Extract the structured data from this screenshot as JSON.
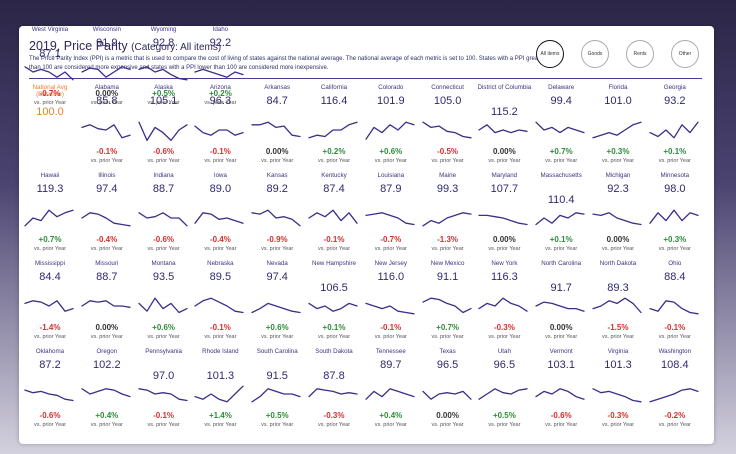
{
  "header": {
    "title": "2019, Price Parity",
    "category": "(Category: All items)",
    "description": "The Price Parity Index (PPI) is a metric that is used to compare the cost of living of states against the national average. The national average of each metric is set to 100. States with a PPI greater than 100 are considered more expensive and states with a PPI lower than 100 are considered more inexpensive."
  },
  "filters": [
    {
      "label": "All items",
      "active": true
    },
    {
      "label": "Goods",
      "active": false
    },
    {
      "label": "Rents",
      "active": false
    },
    {
      "label": "Other",
      "active": false
    }
  ],
  "colors": {
    "accent": "#3d2d8a",
    "national": "#e8822a",
    "negative": "#d32f2f",
    "positive": "#2e8b3a"
  },
  "national": {
    "name": "National Avg (Baseline)",
    "value": "100.0"
  },
  "states": [
    {
      "name": "Alabama",
      "value": "85.8",
      "change": "-0.1%",
      "sub": "vs. prior Year",
      "trend": [
        0.4,
        0.3,
        0.45,
        0.5,
        0.3,
        0.8,
        0.7
      ]
    },
    {
      "name": "Alaska",
      "value": "105.1",
      "change": "-0.6%",
      "sub": "vs. prior Year",
      "trend": [
        0.2,
        0.9,
        0.4,
        0.6,
        0.9,
        0.5,
        0.3
      ]
    },
    {
      "name": "Arizona",
      "value": "96.3",
      "change": "-0.1%",
      "sub": "vs. prior Year",
      "trend": [
        0.35,
        0.6,
        0.7,
        0.5,
        0.5,
        0.7,
        0.6
      ]
    },
    {
      "name": "Arkansas",
      "value": "84.7",
      "change": "0.00%",
      "sub": "vs. prior Year",
      "trend": [
        0.3,
        0.3,
        0.2,
        0.4,
        0.35,
        0.7,
        0.75
      ]
    },
    {
      "name": "California",
      "value": "116.4",
      "change": "+0.2%",
      "sub": "vs. prior Year",
      "trend": [
        0.8,
        0.7,
        0.75,
        0.5,
        0.5,
        0.3,
        0.2
      ]
    },
    {
      "name": "Colorado",
      "value": "101.9",
      "change": "+0.6%",
      "sub": "vs. prior Year",
      "trend": [
        0.85,
        0.4,
        0.6,
        0.3,
        0.5,
        0.2,
        0.3
      ]
    },
    {
      "name": "Connecticut",
      "value": "105.0",
      "change": "-0.5%",
      "sub": "vs. prior Year",
      "trend": [
        0.2,
        0.4,
        0.35,
        0.55,
        0.6,
        0.75,
        0.8
      ]
    },
    {
      "name": "District of Columbia",
      "value": "115.2",
      "change": "0.00%",
      "sub": "vs. prior Year",
      "trend": [
        0.5,
        0.3,
        0.6,
        0.5,
        0.6,
        0.5,
        0.55
      ]
    },
    {
      "name": "Delaware",
      "value": "99.4",
      "change": "+0.7%",
      "sub": "vs. prior Year",
      "trend": [
        0.2,
        0.5,
        0.4,
        0.6,
        0.4,
        0.5,
        0.6
      ]
    },
    {
      "name": "Florida",
      "value": "101.0",
      "change": "+0.3%",
      "sub": "vs. prior Year",
      "trend": [
        0.8,
        0.7,
        0.6,
        0.7,
        0.5,
        0.3,
        0.2
      ]
    },
    {
      "name": "Georgia",
      "value": "93.2",
      "change": "+0.1%",
      "sub": "vs. prior Year",
      "trend": [
        0.6,
        0.75,
        0.5,
        0.8,
        0.3,
        0.6,
        0.2
      ]
    },
    {
      "name": "Hawaii",
      "value": "119.3",
      "change": "+0.7%",
      "sub": "vs. prior Year",
      "trend": [
        0.8,
        0.5,
        0.6,
        0.2,
        0.45,
        0.3,
        0.2
      ]
    },
    {
      "name": "Illinois",
      "value": "97.4",
      "change": "-0.4%",
      "sub": "vs. prior Year",
      "trend": [
        0.5,
        0.3,
        0.35,
        0.5,
        0.7,
        0.75,
        0.8
      ]
    },
    {
      "name": "Indiana",
      "value": "88.7",
      "change": "-0.6%",
      "sub": "vs. prior Year",
      "trend": [
        0.3,
        0.5,
        0.45,
        0.3,
        0.5,
        0.5,
        0.8
      ]
    },
    {
      "name": "Iowa",
      "value": "89.0",
      "change": "-0.4%",
      "sub": "vs. prior Year",
      "trend": [
        0.7,
        0.3,
        0.35,
        0.55,
        0.5,
        0.6,
        0.7
      ]
    },
    {
      "name": "Kansas",
      "value": "89.2",
      "change": "-0.9%",
      "sub": "vs. prior Year",
      "trend": [
        0.3,
        0.35,
        0.2,
        0.5,
        0.45,
        0.55,
        0.8
      ]
    },
    {
      "name": "Kentucky",
      "value": "87.4",
      "change": "-0.1%",
      "sub": "vs. prior Year",
      "trend": [
        0.5,
        0.3,
        0.45,
        0.2,
        0.6,
        0.3,
        0.7
      ]
    },
    {
      "name": "Louisiana",
      "value": "87.9",
      "change": "-0.7%",
      "sub": "vs. prior Year",
      "trend": [
        0.4,
        0.35,
        0.3,
        0.4,
        0.5,
        0.7,
        0.75
      ]
    },
    {
      "name": "Maine",
      "value": "99.3",
      "change": "-1.3%",
      "sub": "vs. prior Year",
      "trend": [
        0.8,
        0.6,
        0.7,
        0.5,
        0.4,
        0.3,
        0.35
      ]
    },
    {
      "name": "Maryland",
      "value": "107.7",
      "change": "0.00%",
      "sub": "vs. prior Year",
      "trend": [
        0.4,
        0.4,
        0.45,
        0.5,
        0.6,
        0.7,
        0.75
      ]
    },
    {
      "name": "Massachusetts",
      "value": "110.4",
      "change": "+0.1%",
      "sub": "vs. prior Year",
      "trend": [
        0.75,
        0.5,
        0.7,
        0.4,
        0.5,
        0.3,
        0.35
      ]
    },
    {
      "name": "Michigan",
      "value": "92.3",
      "change": "0.00%",
      "sub": "vs. prior Year",
      "trend": [
        0.35,
        0.4,
        0.3,
        0.5,
        0.6,
        0.7,
        0.75
      ]
    },
    {
      "name": "Minnesota",
      "value": "98.0",
      "change": "+0.3%",
      "sub": "vs. prior Year",
      "trend": [
        0.7,
        0.3,
        0.6,
        0.2,
        0.6,
        0.3,
        0.4
      ]
    },
    {
      "name": "Mississippi",
      "value": "84.4",
      "change": "-1.4%",
      "sub": "vs. prior Year",
      "trend": [
        0.4,
        0.3,
        0.35,
        0.5,
        0.3,
        0.7,
        0.6
      ]
    },
    {
      "name": "Missouri",
      "value": "88.7",
      "change": "0.00%",
      "sub": "vs. prior Year",
      "trend": [
        0.5,
        0.3,
        0.35,
        0.3,
        0.5,
        0.5,
        0.55
      ]
    },
    {
      "name": "Montana",
      "value": "93.5",
      "change": "+0.6%",
      "sub": "vs. prior Year",
      "trend": [
        0.4,
        0.7,
        0.2,
        0.6,
        0.4,
        0.75,
        0.6
      ]
    },
    {
      "name": "Nebraska",
      "value": "89.5",
      "change": "-0.1%",
      "sub": "vs. prior Year",
      "trend": [
        0.5,
        0.3,
        0.2,
        0.35,
        0.5,
        0.7,
        0.75
      ]
    },
    {
      "name": "Nevada",
      "value": "97.4",
      "change": "+0.6%",
      "sub": "vs. prior Year",
      "trend": [
        0.75,
        0.6,
        0.4,
        0.5,
        0.6,
        0.7,
        0.75
      ]
    },
    {
      "name": "New Hampshire",
      "value": "106.5",
      "change": "+0.1%",
      "sub": "vs. prior Year",
      "trend": [
        0.4,
        0.6,
        0.5,
        0.7,
        0.6,
        0.4,
        0.5
      ]
    },
    {
      "name": "New Jersey",
      "value": "116.0",
      "change": "-0.1%",
      "sub": "vs. prior Year",
      "trend": [
        0.4,
        0.5,
        0.6,
        0.5,
        0.7,
        0.75,
        0.8
      ]
    },
    {
      "name": "New Mexico",
      "value": "91.1",
      "change": "+0.7%",
      "sub": "vs. prior Year",
      "trend": [
        0.35,
        0.2,
        0.25,
        0.4,
        0.5,
        0.75,
        0.6
      ]
    },
    {
      "name": "New York",
      "value": "116.3",
      "change": "-0.3%",
      "sub": "vs. prior Year",
      "trend": [
        0.6,
        0.4,
        0.5,
        0.2,
        0.4,
        0.5,
        0.7
      ]
    },
    {
      "name": "North Carolina",
      "value": "91.7",
      "change": "0.00%",
      "sub": "vs. prior Year",
      "trend": [
        0.5,
        0.35,
        0.4,
        0.5,
        0.6,
        0.6,
        0.7
      ]
    },
    {
      "name": "North Dakota",
      "value": "89.3",
      "change": "-1.5%",
      "sub": "vs. prior Year",
      "trend": [
        0.6,
        0.5,
        0.3,
        0.4,
        0.2,
        0.4,
        0.75
      ]
    },
    {
      "name": "Ohio",
      "value": "88.4",
      "change": "-0.1%",
      "sub": "vs. prior Year",
      "trend": [
        0.6,
        0.7,
        0.3,
        0.35,
        0.6,
        0.75,
        0.8
      ]
    },
    {
      "name": "Oklahoma",
      "value": "87.2",
      "change": "-0.6%",
      "sub": "vs. prior Year",
      "trend": [
        0.35,
        0.45,
        0.4,
        0.5,
        0.55,
        0.7,
        0.75
      ]
    },
    {
      "name": "Oregon",
      "value": "102.2",
      "change": "+0.4%",
      "sub": "vs. prior Year",
      "trend": [
        0.3,
        0.5,
        0.4,
        0.3,
        0.35,
        0.5,
        0.6
      ]
    },
    {
      "name": "Pennsylvania",
      "value": "97.0",
      "change": "-0.1%",
      "sub": "vs. prior Year",
      "trend": [
        0.3,
        0.35,
        0.5,
        0.45,
        0.5,
        0.7,
        0.75
      ]
    },
    {
      "name": "Rhode Island",
      "value": "101.3",
      "change": "+1.4%",
      "sub": "vs. prior Year",
      "trend": [
        0.6,
        0.7,
        0.5,
        0.7,
        0.8,
        0.5,
        0.2
      ]
    },
    {
      "name": "South Carolina",
      "value": "91.5",
      "change": "+0.5%",
      "sub": "vs. prior Year",
      "trend": [
        0.8,
        0.6,
        0.3,
        0.4,
        0.5,
        0.5,
        0.6
      ]
    },
    {
      "name": "South Dakota",
      "value": "87.8",
      "change": "-0.3%",
      "sub": "vs. prior Year",
      "trend": [
        0.6,
        0.3,
        0.35,
        0.4,
        0.5,
        0.45,
        0.5
      ]
    },
    {
      "name": "Tennessee",
      "value": "89.7",
      "change": "+0.4%",
      "sub": "vs. prior Year",
      "trend": [
        0.7,
        0.4,
        0.6,
        0.3,
        0.4,
        0.5,
        0.6
      ]
    },
    {
      "name": "Texas",
      "value": "96.5",
      "change": "0.00%",
      "sub": "vs. prior Year",
      "trend": [
        0.4,
        0.7,
        0.5,
        0.45,
        0.5,
        0.4,
        0.7
      ]
    },
    {
      "name": "Utah",
      "value": "96.5",
      "change": "+0.5%",
      "sub": "vs. prior Year",
      "trend": [
        0.7,
        0.5,
        0.3,
        0.45,
        0.5,
        0.35,
        0.3
      ]
    },
    {
      "name": "Vermont",
      "value": "103.1",
      "change": "-0.6%",
      "sub": "vs. prior Year",
      "trend": [
        0.6,
        0.4,
        0.5,
        0.3,
        0.4,
        0.6,
        0.7
      ]
    },
    {
      "name": "Virginia",
      "value": "101.3",
      "change": "-0.3%",
      "sub": "vs. prior Year",
      "trend": [
        0.3,
        0.45,
        0.4,
        0.5,
        0.6,
        0.75,
        0.8
      ]
    },
    {
      "name": "Washington",
      "value": "108.4",
      "change": "-0.2%",
      "sub": "vs. prior Year",
      "trend": [
        0.8,
        0.7,
        0.6,
        0.5,
        0.35,
        0.3,
        0.4
      ]
    },
    {
      "name": "West Virginia",
      "value": "87.1",
      "change": "-0.7%",
      "sub": "vs. prior Year",
      "trend": [
        0.3,
        0.5,
        0.4,
        0.5,
        0.7,
        0.5,
        0.8
      ]
    },
    {
      "name": "Wisconsin",
      "value": "91.9",
      "change": "0.00%",
      "sub": "vs. prior Year",
      "trend": [
        0.5,
        0.35,
        0.4,
        0.7,
        0.5,
        0.3,
        0.4
      ]
    },
    {
      "name": "Wyoming",
      "value": "92.8",
      "change": "+0.5%",
      "sub": "vs. prior Year",
      "trend": [
        0.4,
        0.3,
        0.5,
        0.4,
        0.6,
        0.75,
        0.8
      ]
    },
    {
      "name": "Idaho",
      "value": "92.2",
      "change": "+0.2%",
      "sub": "vs. prior Year",
      "trend": [
        0.5,
        0.4,
        0.5,
        0.6,
        0.7,
        0.5,
        0.6
      ]
    }
  ]
}
